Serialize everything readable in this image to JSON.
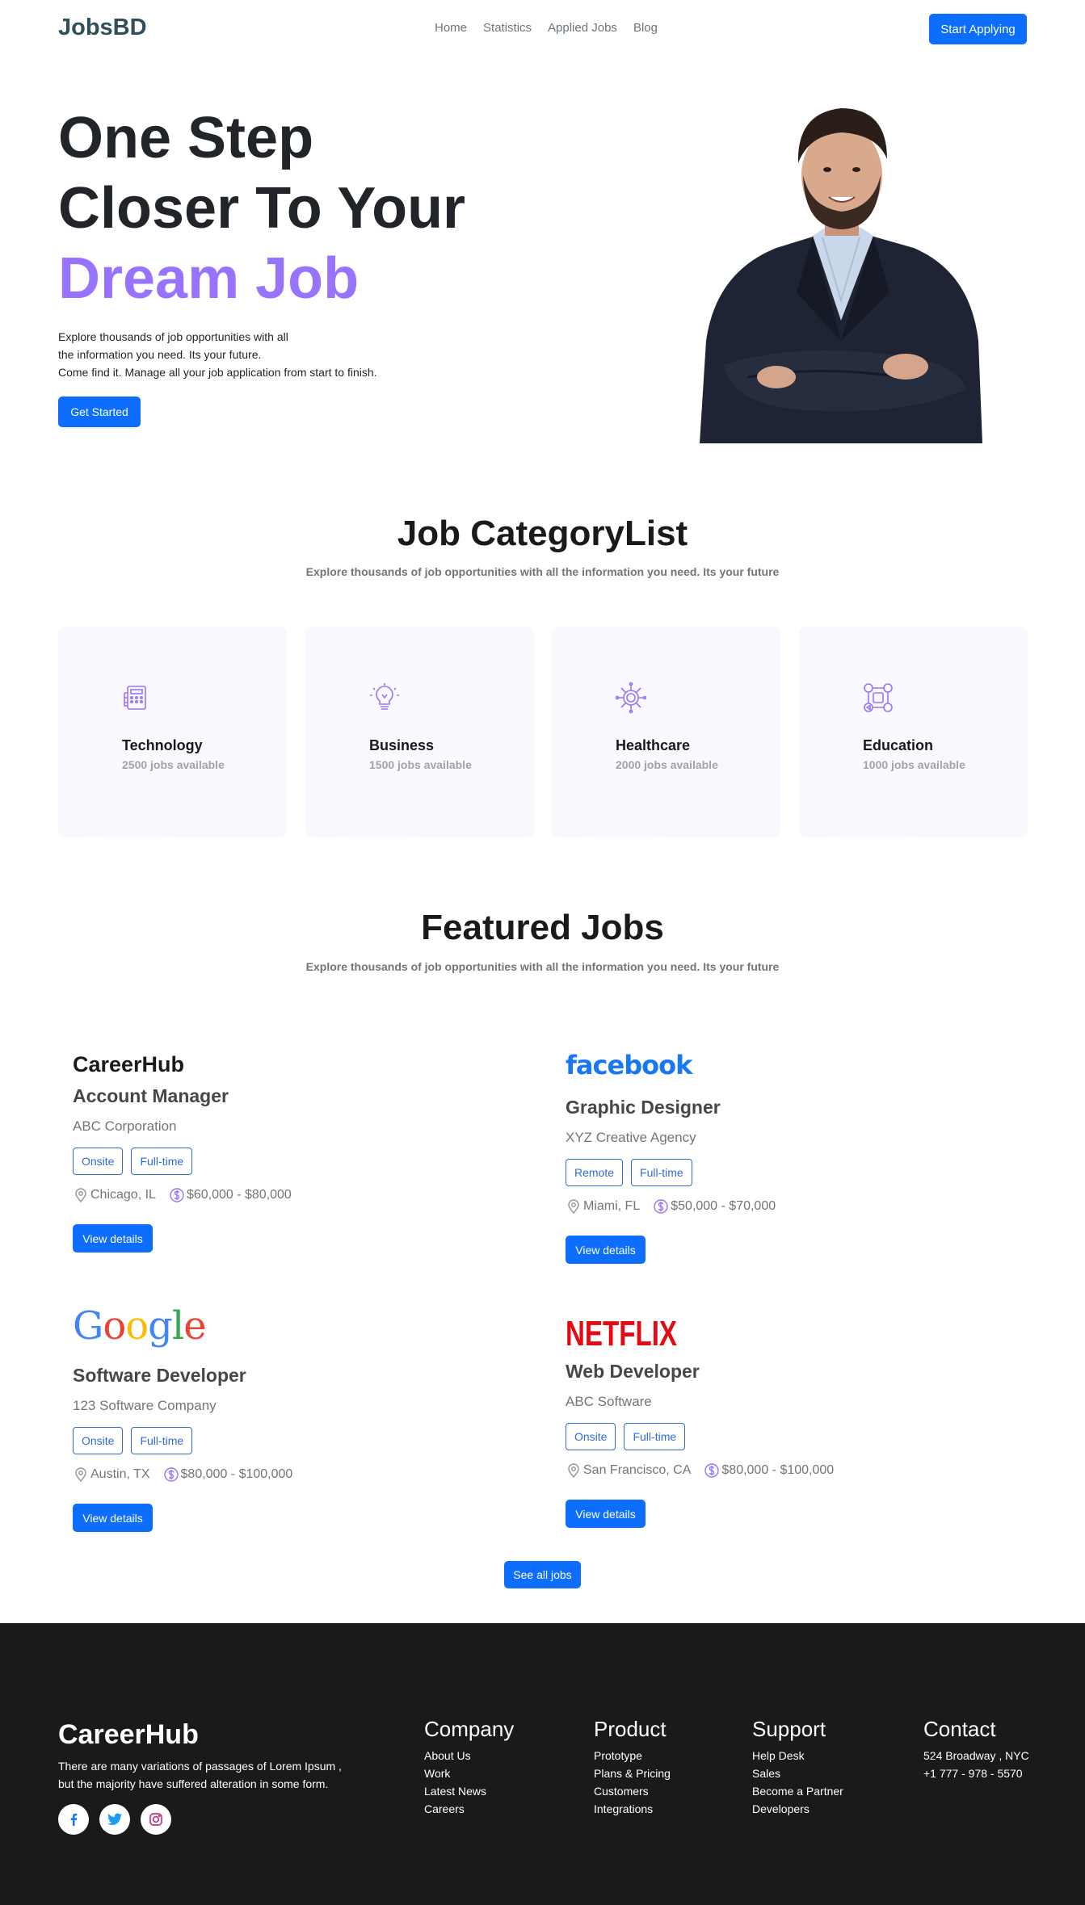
{
  "nav": {
    "brand": "JobsBD",
    "links": [
      "Home",
      "Statistics",
      "Applied Jobs",
      "Blog"
    ],
    "cta": "Start Applying"
  },
  "hero": {
    "title_line1": "One Step",
    "title_line2": "Closer To Your",
    "title_accent": "Dream Job",
    "desc_line1": "Explore thousands of job opportunities with all",
    "desc_line2": "the information you need. Its your future.",
    "desc_line3": "Come find it. Manage all your job application from start to finish.",
    "cta": "Get Started"
  },
  "categories": {
    "title": "Job CategoryList",
    "subtitle": "Explore thousands of job opportunities with all the information you need. Its your future",
    "items": [
      {
        "name": "Technology",
        "count": "2500 jobs available",
        "icon": "accounts-icon"
      },
      {
        "name": "Business",
        "count": "1500 jobs available",
        "icon": "lightbulb-icon"
      },
      {
        "name": "Healthcare",
        "count": "2000 jobs available",
        "icon": "chip-icon"
      },
      {
        "name": "Education",
        "count": "1000 jobs available",
        "icon": "social-media-icon"
      }
    ]
  },
  "featured": {
    "title": "Featured Jobs",
    "subtitle": "Explore thousands of job opportunities with all the information you need. Its your future",
    "jobs": [
      {
        "logo": "CareerHub",
        "title": "Account Manager",
        "company": "ABC Corporation",
        "tags": [
          "Onsite",
          "Full-time"
        ],
        "location": "Chicago, IL",
        "salary": "$60,000 - $80,000",
        "button": "View details"
      },
      {
        "logo": "facebook",
        "title": "Graphic Designer",
        "company": "XYZ Creative Agency",
        "tags": [
          "Remote",
          "Full-time"
        ],
        "location": "Miami, FL",
        "salary": "$50,000 - $70,000",
        "button": "View details"
      },
      {
        "logo": "Google",
        "title": "Software Developer",
        "company": "123 Software Company",
        "tags": [
          "Onsite",
          "Full-time"
        ],
        "location": "Austin, TX",
        "salary": "$80,000 - $100,000",
        "button": "View details"
      },
      {
        "logo": "NETFLIX",
        "title": "Web Developer",
        "company": "ABC Software",
        "tags": [
          "Onsite",
          "Full-time"
        ],
        "location": "San Francisco, CA",
        "salary": "$80,000 - $100,000",
        "button": "View details"
      }
    ],
    "see_all": "See all jobs"
  },
  "footer": {
    "brand": "CareerHub",
    "desc_line1": "There are many variations of passages of Lorem Ipsum ,",
    "desc_line2": "but the majority have suffered alteration in some form.",
    "socials": [
      "facebook-icon",
      "twitter-icon",
      "instagram-icon"
    ],
    "company": {
      "title": "Company",
      "items": [
        "About Us",
        "Work",
        "Latest News",
        "Careers"
      ]
    },
    "product": {
      "title": "Product",
      "items": [
        "Prototype",
        "Plans & Pricing",
        "Customers",
        "Integrations"
      ]
    },
    "support": {
      "title": "Support",
      "items": [
        "Help Desk",
        "Sales",
        "Become a Partner",
        "Developers"
      ]
    },
    "contact": {
      "title": "Contact",
      "items": [
        "524 Broadway , NYC",
        "+1 777 - 978 - 5570"
      ]
    }
  },
  "colors": {
    "primary": "#0d6efd",
    "accent": "#9873ff",
    "footer_bg": "#1a1a1a"
  }
}
